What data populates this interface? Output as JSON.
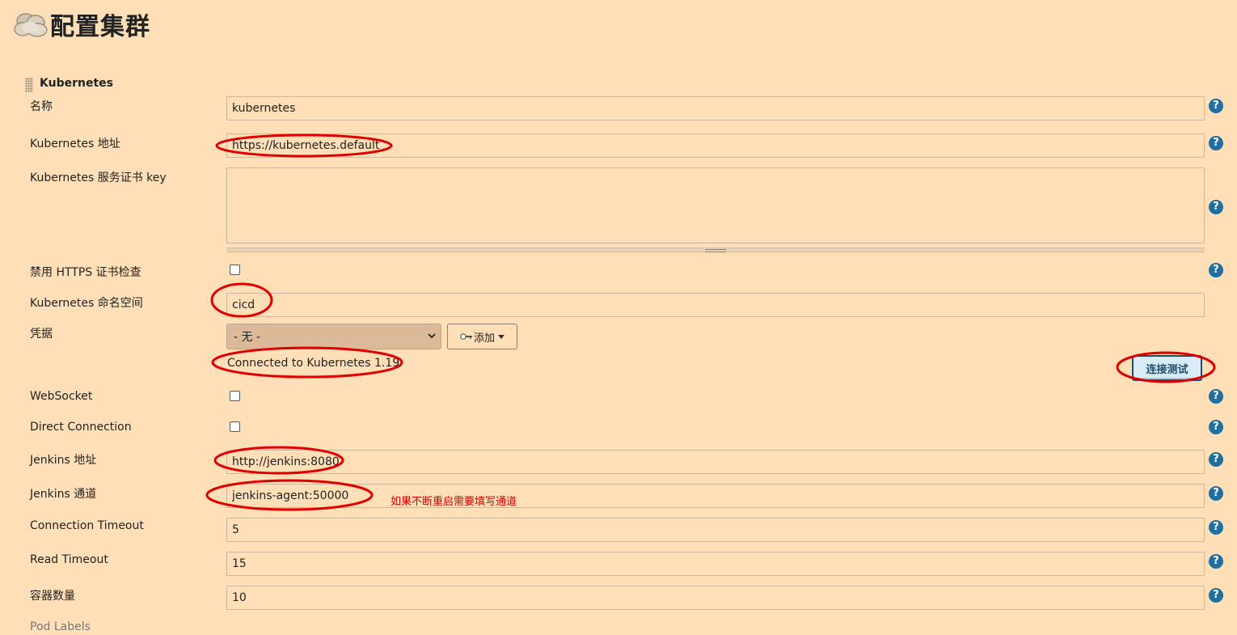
{
  "page": {
    "title": "配置集群",
    "title_icon": "clouds-icon"
  },
  "section": {
    "title": "Kubernetes"
  },
  "fields": {
    "name": {
      "label": "名称",
      "value": "kubernetes"
    },
    "url": {
      "label": "Kubernetes 地址",
      "value": "https://kubernetes.default"
    },
    "server_cert": {
      "label": "Kubernetes 服务证书 key",
      "value": ""
    },
    "skip_tls": {
      "label": "禁用 HTTPS 证书检查",
      "checked": false
    },
    "namespace": {
      "label": "Kubernetes 命名空间",
      "value": "cicd"
    },
    "credentials": {
      "label": "凭据",
      "selected": "- 无 -",
      "add_label": "添加"
    },
    "websocket": {
      "label": "WebSocket",
      "checked": false
    },
    "direct_connection": {
      "label": "Direct Connection",
      "checked": false
    },
    "jenkins_url": {
      "label": "Jenkins 地址",
      "value": "http://jenkins:8080"
    },
    "jenkins_tunnel": {
      "label": "Jenkins 通道",
      "value": "jenkins-agent:50000"
    },
    "connection_timeout": {
      "label": "Connection Timeout",
      "value": "5"
    },
    "read_timeout": {
      "label": "Read Timeout",
      "value": "15"
    },
    "container_cap": {
      "label": "容器数量",
      "value": "10"
    },
    "pod_labels": {
      "label": "Pod Labels"
    }
  },
  "connection": {
    "status": "Connected to Kubernetes 1.19",
    "test_button": "连接测试"
  },
  "annotation_note": "如果不断重启需要填写通道",
  "help_glyph": "?",
  "colors": {
    "background": "#ffdfb7",
    "annotation_red": "#e00000",
    "help_blue": "#1f6fa0"
  }
}
